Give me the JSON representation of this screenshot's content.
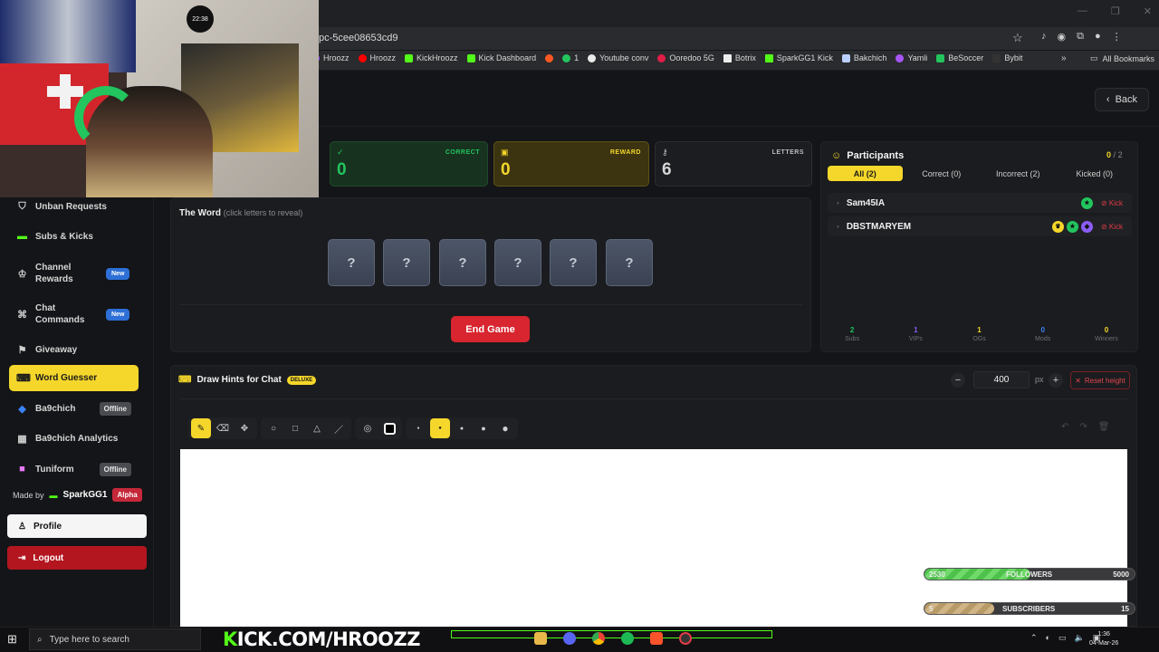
{
  "browser": {
    "url": "pc-5cee08653cd9",
    "bookmarks": [
      "Hroozz",
      "Hroozz",
      "KickHroozz",
      "Kick Dashboard",
      "1",
      "Youtube conv",
      "Ooredoo 5G",
      "Botrix",
      "SparkGG1 Kick",
      "Bakchich",
      "Yamli",
      "BeSoccer",
      "Bybit"
    ],
    "all_bookmarks": "All Bookmarks"
  },
  "header": {
    "back_label": "Back"
  },
  "webcam": {
    "clock": "22:38"
  },
  "sidebar": {
    "items": [
      {
        "label": "Unban Requests",
        "icon": "shield-icon"
      },
      {
        "label": "Subs & Kicks",
        "icon": "kick-icon"
      },
      {
        "label": "Channel Rewards",
        "icon": "reward-icon",
        "badge": "New"
      },
      {
        "label": "Chat Commands",
        "icon": "command-icon",
        "badge": "New"
      },
      {
        "label": "Giveaway",
        "icon": "gift-icon"
      },
      {
        "label": "Word Guesser",
        "icon": "gamepad-icon"
      },
      {
        "label": "Ba9chich",
        "icon": "ba9chich-icon",
        "badge": "Offline"
      },
      {
        "label": "Ba9chich Analytics",
        "icon": "analytics-icon"
      },
      {
        "label": "Tuniform",
        "icon": "tuniform-icon",
        "badge": "Offline"
      }
    ],
    "made_by": "Made by",
    "brand": "SparkGG1",
    "alpha": "Alpha",
    "profile": "Profile",
    "logout": "Logout"
  },
  "stats": {
    "correct": {
      "label": "CORRECT",
      "value": "0"
    },
    "reward": {
      "label": "REWARD",
      "value": "0"
    },
    "letters": {
      "label": "LETTERS",
      "value": "6"
    }
  },
  "word": {
    "title": "The Word",
    "hint": "(click letters to reveal)",
    "tiles": [
      "?",
      "?",
      "?",
      "?",
      "?",
      "?"
    ],
    "end_game": "End Game"
  },
  "participants": {
    "title": "Participants",
    "count_current": "0",
    "count_sep": "/",
    "count_total": "2",
    "tabs": [
      "All (2)",
      "Correct (0)",
      "Incorrect (2)",
      "Kicked (0)"
    ],
    "rows": [
      {
        "name": "Sam45IA",
        "kick": "Kick"
      },
      {
        "name": "DBSTMARYEM",
        "kick": "Kick"
      }
    ],
    "stats": [
      {
        "n": "2",
        "label": "Subs",
        "color": "#22c55e"
      },
      {
        "n": "1",
        "label": "VIPs",
        "color": "#8b5cf6"
      },
      {
        "n": "1",
        "label": "OGs",
        "color": "#f5d72b"
      },
      {
        "n": "0",
        "label": "Mods",
        "color": "#3b82f6"
      },
      {
        "n": "0",
        "label": "Winners",
        "color": "#f5d72b"
      }
    ]
  },
  "draw": {
    "title": "Draw Hints for Chat",
    "deluxe": "DELUXE",
    "height": "400",
    "px": "px",
    "reset": "Reset height"
  },
  "overlay": {
    "followers": {
      "left": "2530",
      "label": "FOLLOWERS",
      "right": "5000",
      "progress": 0.506
    },
    "subscribers": {
      "left": "5",
      "label": "SUBSCRIBERS",
      "right": "15",
      "progress": 0.33
    }
  },
  "taskbar": {
    "search": "Type here to search",
    "banner_k": "K",
    "banner_rest": "ICK.COM/HROOZZ",
    "time": "1:36",
    "date": "04-Mar-26"
  }
}
